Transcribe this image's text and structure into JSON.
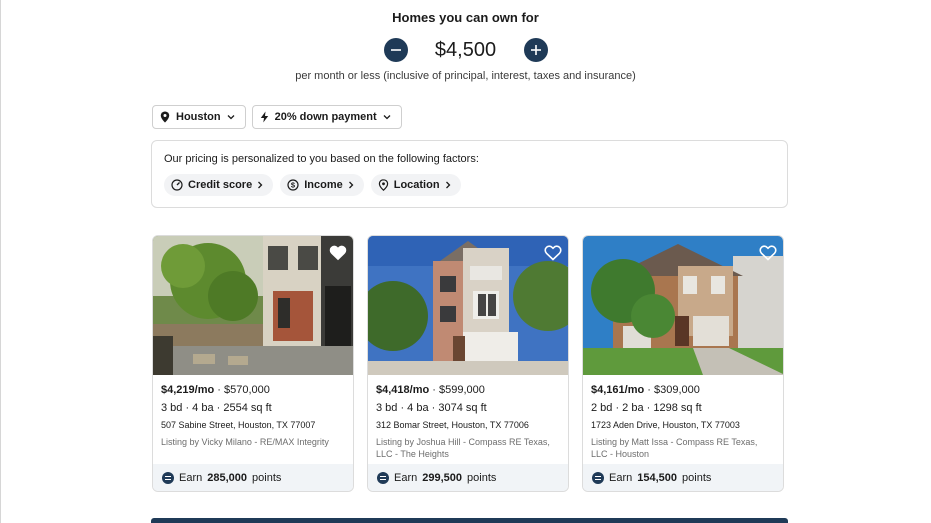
{
  "heading": "Homes you can own for",
  "budget": {
    "amount": "$4,500",
    "subtext": "per month or less (inclusive of principal, interest, taxes and insurance)"
  },
  "filters": {
    "location": "Houston",
    "down_payment": "20% down payment"
  },
  "factors": {
    "text": "Our pricing is personalized to you based on the following factors:",
    "chips": [
      "Credit score",
      "Income",
      "Location"
    ]
  },
  "listings": [
    {
      "monthly": "$4,219/mo",
      "price": "$570,000",
      "specs": "3 bd · 4 ba · 2554 sq ft",
      "address": "507 Sabine Street, Houston, TX 77007",
      "listing": "Listing by Vicky Milano - RE/MAX Integrity",
      "points_value": "285,000"
    },
    {
      "monthly": "$4,418/mo",
      "price": "$599,000",
      "specs": "3 bd · 4 ba · 3074 sq ft",
      "address": "312 Bomar Street, Houston, TX 77006",
      "listing": "Listing by Joshua Hill - Compass RE Texas, LLC - The Heights",
      "points_value": "299,500"
    },
    {
      "monthly": "$4,161/mo",
      "price": "$309,000",
      "specs": "2 bd · 2 ba · 1298 sq ft",
      "address": "1723 Aden Drive, Houston, TX 77003",
      "listing": "Listing by Matt Issa - Compass RE Texas, LLC - Houston",
      "points_value": "154,500"
    }
  ],
  "points": {
    "prefix": "Earn",
    "suffix": "points"
  },
  "separator": "·",
  "colors": {
    "accent": "#1f3a57",
    "chip_bg": "#f2f3f5",
    "points_bg": "#f1f4f7"
  }
}
